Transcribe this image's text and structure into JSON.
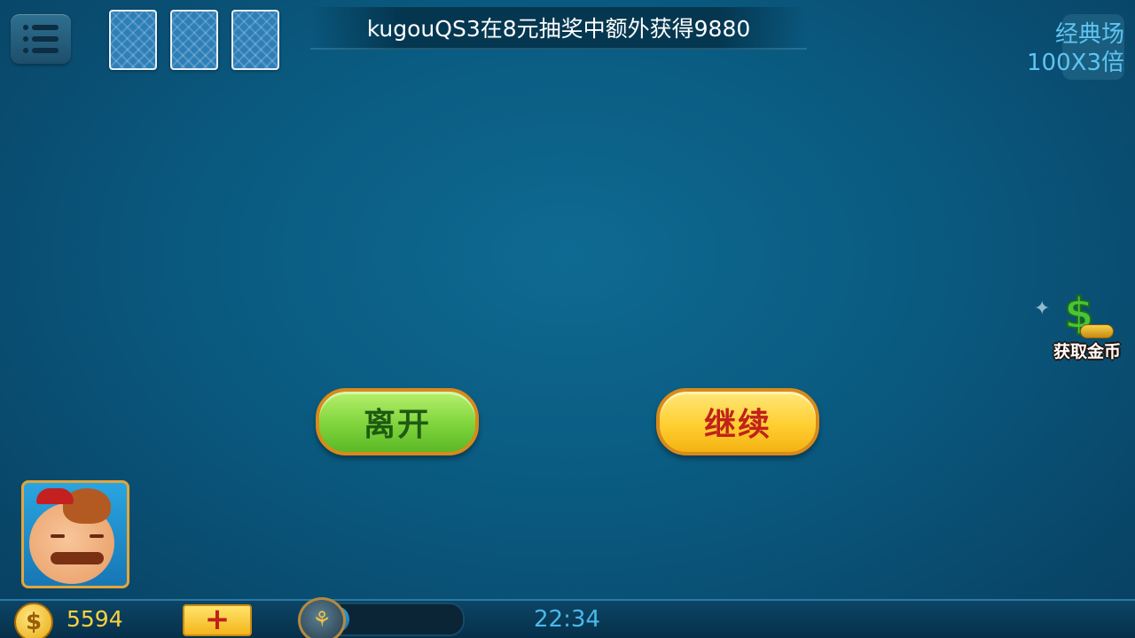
{
  "top_bar": {
    "marquee_text": "kugouQS3在8元抽奖中额外获得9880",
    "card_count": 3
  },
  "room": {
    "name": "经典场",
    "multiplier": "100X3倍"
  },
  "side": {
    "get_coins_label": "获取金币",
    "get_coins_icon": "dollar-coins-icon"
  },
  "dialog": {
    "leave_label": "离开",
    "continue_label": "继续"
  },
  "bottom_bar": {
    "coin_icon": "$",
    "coin_balance": "5594",
    "add_icon": "+",
    "progress_fraction": 0.2,
    "time": "22:34"
  },
  "colors": {
    "table_blue": "#0a5a80",
    "leave_green": "#7fd43c",
    "continue_yellow": "#ffcf32",
    "gold_text": "#ffd040",
    "room_text": "#5ec4f2"
  }
}
